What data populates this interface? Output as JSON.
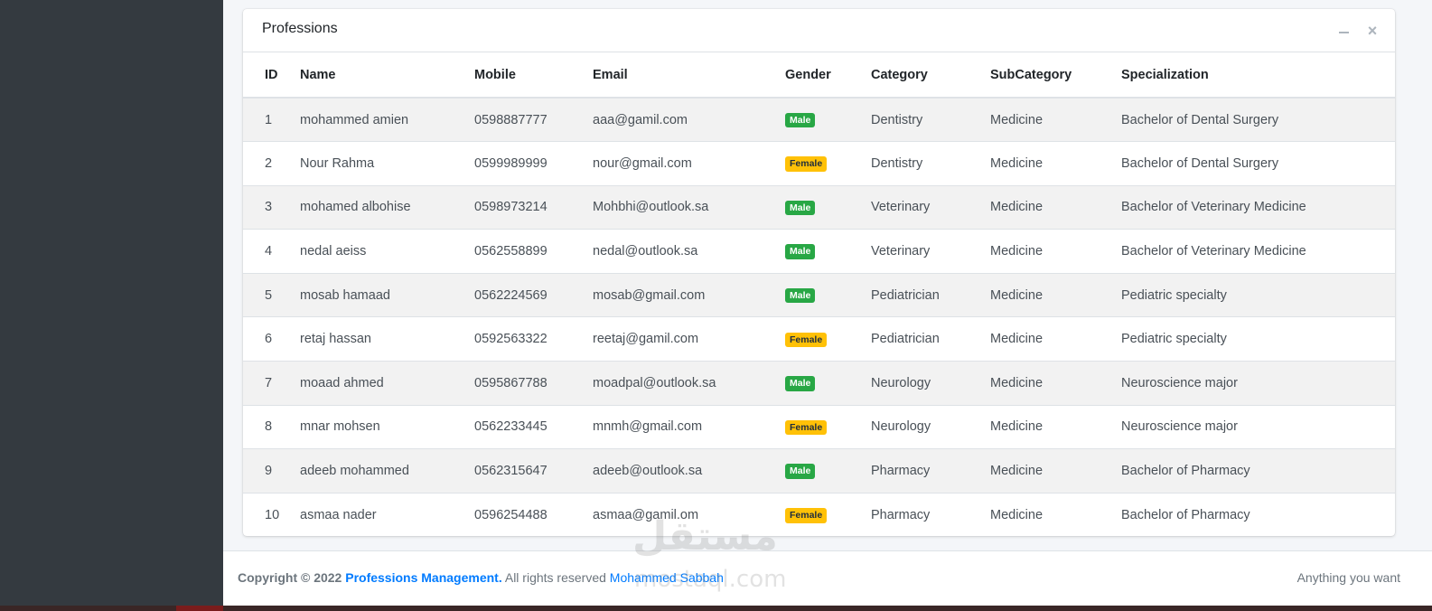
{
  "card": {
    "title": "Professions"
  },
  "table": {
    "headers": [
      "ID",
      "Name",
      "Mobile",
      "Email",
      "Gender",
      "Category",
      "SubCategory",
      "Specialization"
    ],
    "rows": [
      {
        "id": "1",
        "name": "mohammed amien",
        "mobile": "0598887777",
        "email": "aaa@gamil.com",
        "gender": "Male",
        "category": "Dentistry",
        "subcategory": "Medicine",
        "specialization": "Bachelor of Dental Surgery"
      },
      {
        "id": "2",
        "name": "Nour Rahma",
        "mobile": "0599989999",
        "email": "nour@gmail.com",
        "gender": "Female",
        "category": "Dentistry",
        "subcategory": "Medicine",
        "specialization": "Bachelor of Dental Surgery"
      },
      {
        "id": "3",
        "name": "mohamed albohise",
        "mobile": "0598973214",
        "email": "Mohbhi@outlook.sa",
        "gender": "Male",
        "category": "Veterinary",
        "subcategory": "Medicine",
        "specialization": "Bachelor of Veterinary Medicine"
      },
      {
        "id": "4",
        "name": "nedal aeiss",
        "mobile": "0562558899",
        "email": "nedal@outlook.sa",
        "gender": "Male",
        "category": "Veterinary",
        "subcategory": "Medicine",
        "specialization": "Bachelor of Veterinary Medicine"
      },
      {
        "id": "5",
        "name": "mosab hamaad",
        "mobile": "0562224569",
        "email": "mosab@gmail.com",
        "gender": "Male",
        "category": "Pediatrician",
        "subcategory": "Medicine",
        "specialization": "Pediatric specialty"
      },
      {
        "id": "6",
        "name": "retaj hassan",
        "mobile": "0592563322",
        "email": "reetaj@gamil.com",
        "gender": "Female",
        "category": "Pediatrician",
        "subcategory": "Medicine",
        "specialization": "Pediatric specialty"
      },
      {
        "id": "7",
        "name": "moaad ahmed",
        "mobile": "0595867788",
        "email": "moadpal@outlook.sa",
        "gender": "Male",
        "category": "Neurology",
        "subcategory": "Medicine",
        "specialization": "Neuroscience major"
      },
      {
        "id": "8",
        "name": "mnar mohsen",
        "mobile": "0562233445",
        "email": "mnmh@gmail.com",
        "gender": "Female",
        "category": "Neurology",
        "subcategory": "Medicine",
        "specialization": "Neuroscience major"
      },
      {
        "id": "9",
        "name": "adeeb mohammed",
        "mobile": "0562315647",
        "email": "adeeb@outlook.sa",
        "gender": "Male",
        "category": "Pharmacy",
        "subcategory": "Medicine",
        "specialization": "Bachelor of Pharmacy"
      },
      {
        "id": "10",
        "name": "asmaa nader",
        "mobile": "0596254488",
        "email": "asmaa@gamil.om",
        "gender": "Female",
        "category": "Pharmacy",
        "subcategory": "Medicine",
        "specialization": "Bachelor of Pharmacy"
      }
    ]
  },
  "footer": {
    "copyright": "Copyright © 2022",
    "brand": "Professions Management.",
    "rights": "All rights reserved",
    "author": "Mohammed Sabbah",
    "right_text": "Anything you want"
  },
  "watermark": {
    "arabic": "مستقل",
    "latin": "mostaql.com"
  },
  "colors": {
    "sidebar": "#343a40",
    "male_badge": "#28a745",
    "female_badge": "#ffc107",
    "link": "#007bff"
  },
  "icons": {
    "minimize": "minus-icon",
    "close": "close-icon"
  }
}
